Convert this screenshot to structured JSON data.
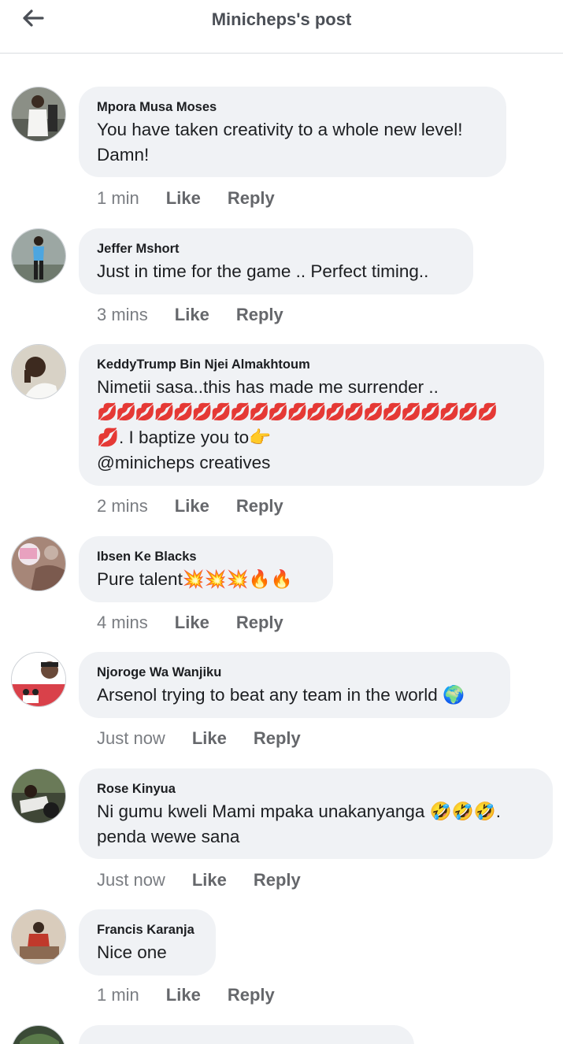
{
  "header": {
    "title": "Minicheps's post",
    "back_icon": "arrow-left-icon"
  },
  "actions": {
    "like": "Like",
    "reply": "Reply"
  },
  "comments": [
    {
      "author": "Mpora Musa Moses",
      "lines": [
        "You have taken creativity to a whole new level!",
        "Damn!"
      ],
      "time": "1 min",
      "avatar_color": "#6d6f63"
    },
    {
      "author": "Jeffer Mshort",
      "lines": [
        "Just in time for the game .. Perfect timing.."
      ],
      "time": "3 mins",
      "avatar_color": "#7d8a86"
    },
    {
      "author": "KeddyTrump Bin Njei Almakhtoum",
      "lines": [
        "Nimetii sasa..this has made me surrender ..",
        "💋💋💋💋💋💋💋💋💋💋💋💋💋💋💋💋💋💋💋💋💋",
        "💋. I baptize you to👉",
        "@minicheps creatives"
      ],
      "time": "2 mins",
      "avatar_color": "#b9a58d"
    },
    {
      "author": "Ibsen Ke Blacks",
      "lines": [
        "Pure talent💥💥💥🔥🔥"
      ],
      "time": "4 mins",
      "avatar_color": "#c2a7b5"
    },
    {
      "author": "Njoroge Wa Wanjiku",
      "lines": [
        "Arsenol trying to beat any team in the world 🌍"
      ],
      "time": "Just now",
      "avatar_color": "#d9414a"
    },
    {
      "author": "Rose Kinyua",
      "lines": [
        "Ni gumu kweli Mami mpaka unakanyanga  🤣🤣🤣.",
        "penda wewe sana"
      ],
      "time": "Just now",
      "avatar_color": "#4c4f3d"
    },
    {
      "author": "Francis Karanja",
      "lines": [
        "Nice one"
      ],
      "time": "1 min",
      "avatar_color": "#a0836c"
    },
    {
      "author": "",
      "lines": [],
      "time": "",
      "avatar_color": "#3a4a36"
    }
  ]
}
